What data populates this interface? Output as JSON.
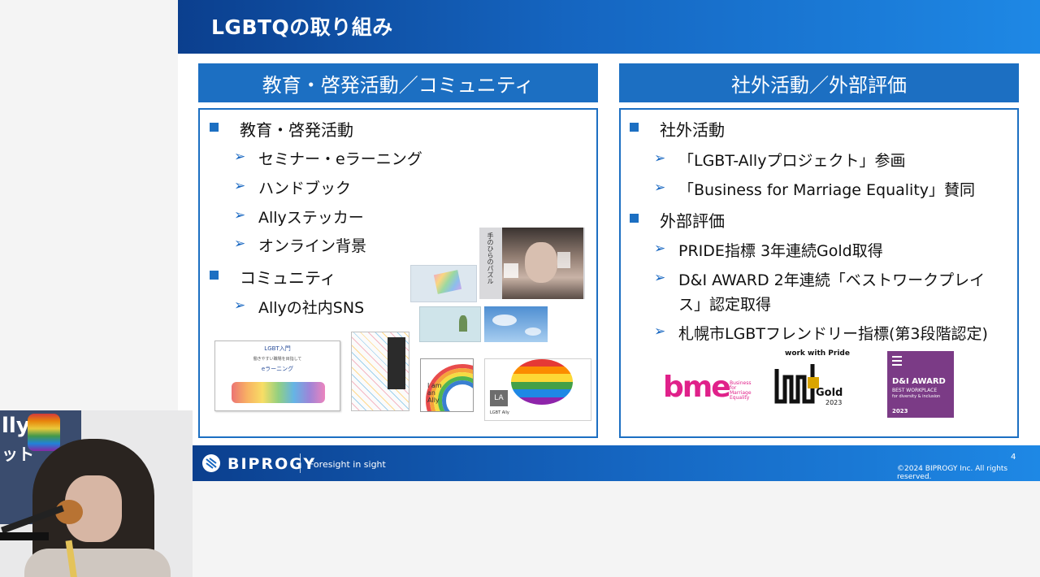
{
  "slide": {
    "title": "LGBTQの取り組み",
    "left_panel": {
      "heading": "教育・啓発活動／コミュニティ",
      "sections": [
        {
          "label": "教育・啓発活動",
          "items": [
            "セミナー・eラーニング",
            "ハンドブック",
            "Allyステッカー",
            "オンライン背景"
          ]
        },
        {
          "label": "コミュニティ",
          "items": [
            "Allyの社内SNS"
          ]
        }
      ],
      "elearning_card": {
        "title": "LGBT入門",
        "subtitle": "働きやすい職場を目指して",
        "label": "eラーニング"
      },
      "sticker": {
        "line1": "I am",
        "line2": "an",
        "line3": "Ally"
      },
      "sns_card": {
        "badge": "LA",
        "caption": "LGBT Ally"
      },
      "puzzle_text": "手のひらのパズル"
    },
    "right_panel": {
      "heading": "社外活動／外部評価",
      "sections": [
        {
          "label": "社外活動",
          "items": [
            "「LGBT-Allyプロジェクト」参画",
            "「Business for Marriage Equality」賛同"
          ]
        },
        {
          "label": "外部評価",
          "items": [
            "PRIDE指標 3年連続Gold取得",
            "D&I AWARD 2年連続「ベストワークプレイス」認定取得",
            "札幌市LGBTフレンドリー指標(第3段階認定)"
          ]
        }
      ],
      "bme_logo": {
        "mark": "bme",
        "text_lines": [
          "Business",
          "for",
          "Marriage",
          "Equality"
        ],
        "color": "#e0218a"
      },
      "pride_logo": {
        "top": "work with Pride",
        "grade": "Gold",
        "year": "2023"
      },
      "di_award": {
        "title": "D&I AWARD",
        "line1": "BEST WORKPLACE",
        "line2": "for diversity & inclusion",
        "year": "2023",
        "color": "#7b3b86"
      }
    },
    "footer": {
      "brand": "BIPROGY",
      "tagline": "Foresight in sight",
      "page": "4",
      "copyright": "©2024 BIPROGY Inc. All rights reserved."
    }
  },
  "webcam": {
    "background_text": [
      "lly",
      "ット"
    ]
  },
  "colors": {
    "accent": "#1c6fc2",
    "title_bar": "#0b3f8e",
    "bme": "#e0218a",
    "di_award": "#7b3b86"
  }
}
